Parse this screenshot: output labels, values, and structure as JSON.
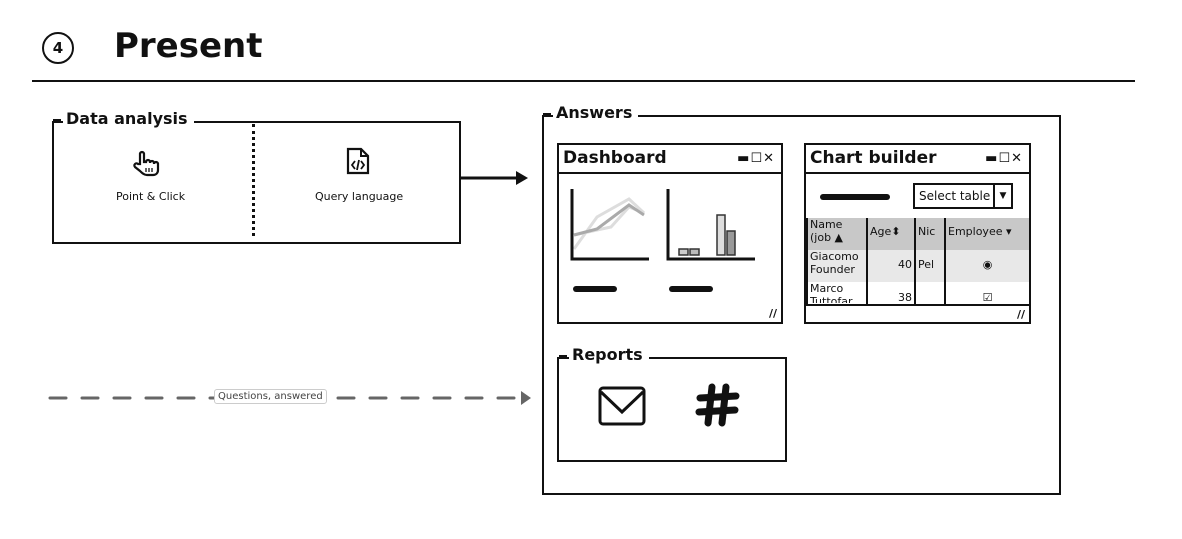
{
  "header": {
    "step_number": "4",
    "title": "Present"
  },
  "data_analysis": {
    "label": "Data analysis",
    "point_click": {
      "label": "Point & Click",
      "icon": "hand-pointer-icon"
    },
    "query": {
      "label": "Query language",
      "icon": "code-file-icon"
    }
  },
  "connector": {
    "label": "Questions, answered"
  },
  "answers": {
    "label": "Answers",
    "dashboard": {
      "title": "Dashboard"
    },
    "chart_builder": {
      "title": "Chart builder",
      "select": "Select table",
      "table": {
        "headers": [
          "Name (job",
          "Age",
          "Nic",
          "Employee"
        ],
        "rows": [
          [
            "Giacomo Founder",
            "40",
            "Pel",
            "radio-selected"
          ],
          [
            "Marco Tuttofar",
            "38",
            "",
            "checkbox-checked"
          ]
        ]
      }
    },
    "reports": {
      "label": "Reports",
      "icons": [
        "mail-icon",
        "slack-icon"
      ]
    }
  }
}
